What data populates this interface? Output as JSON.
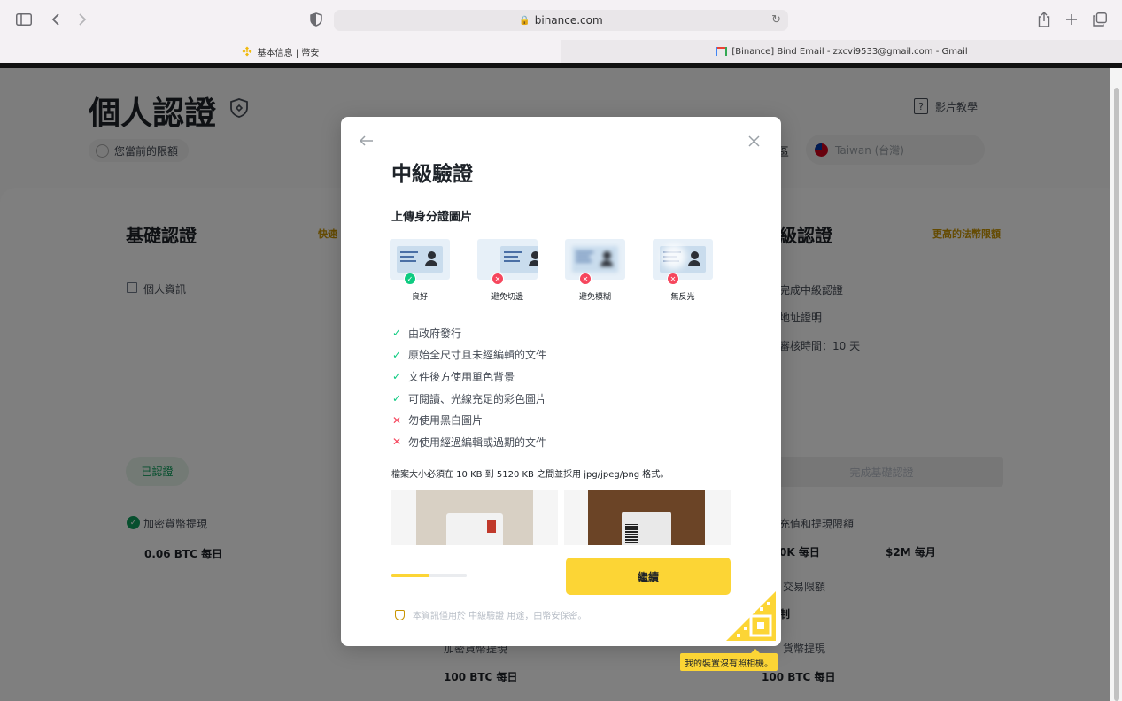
{
  "browser": {
    "url": "binance.com",
    "tabs": [
      {
        "title": "基本信息 | 幣安"
      },
      {
        "title": "[Binance] Bind Email - zxcvi9533@gmail.com - Gmail"
      }
    ]
  },
  "page": {
    "title": "個人認證",
    "current_limit": "您當前的限額",
    "video_tutorial": "影片教學",
    "region_label": "區",
    "country": "Taiwan (台灣)",
    "basic": {
      "title": "基礎認證",
      "quick_link": "快速",
      "personal_info": "個人資訊",
      "verified_badge": "已認證",
      "crypto_withdraw": "加密貨幣提現",
      "crypto_limit": "0.06 BTC 每日"
    },
    "advanced": {
      "title": "級認證",
      "fiat_link": "更高的法幣限額",
      "req1": "完成中級認證",
      "req2": "地址證明",
      "review_time": "審核時間：10 天",
      "complete_basic": "完成基礎認證",
      "deposit_withdraw": "充值和提現限額",
      "daily_limit": "0K 每日",
      "monthly_limit": "$2M 每月",
      "trade_limit": "交易限額",
      "unlimited": "制",
      "crypto_withdraw": "貨幣提現",
      "crypto_limit": "100 BTC 每日"
    },
    "middle": {
      "crypto_withdraw": "加密貨幣提現",
      "crypto_limit": "100 BTC 每日"
    }
  },
  "modal": {
    "title": "中級驗證",
    "subtitle": "上傳身分證圖片",
    "examples": [
      {
        "label": "良好",
        "status": "ok"
      },
      {
        "label": "避免切邊",
        "status": "bad"
      },
      {
        "label": "避免模糊",
        "status": "bad"
      },
      {
        "label": "無反光",
        "status": "bad"
      }
    ],
    "rules": [
      {
        "text": "由政府發行",
        "ok": true
      },
      {
        "text": "原始全尺寸且未經編輯的文件",
        "ok": true
      },
      {
        "text": "文件後方使用單色背景",
        "ok": true
      },
      {
        "text": "可閱讀、光線充足的彩色圖片",
        "ok": true
      },
      {
        "text": "勿使用黑白圖片",
        "ok": false
      },
      {
        "text": "勿使用經過編輯或過期的文件",
        "ok": false
      }
    ],
    "size_note": "檔案大小必須在 10 KB 到 5120 KB 之間並採用 jpg/jpeg/png 格式。",
    "progress": 0.5,
    "continue_label": "繼續",
    "privacy_note": "本資訊僅用於 中級驗證 用途，由幣安保密。",
    "no_camera": "我的裝置沒有照相機。"
  },
  "colors": {
    "accent": "#fcd535",
    "success": "#0ecb81",
    "error": "#f6465d",
    "link": "#c99400"
  }
}
